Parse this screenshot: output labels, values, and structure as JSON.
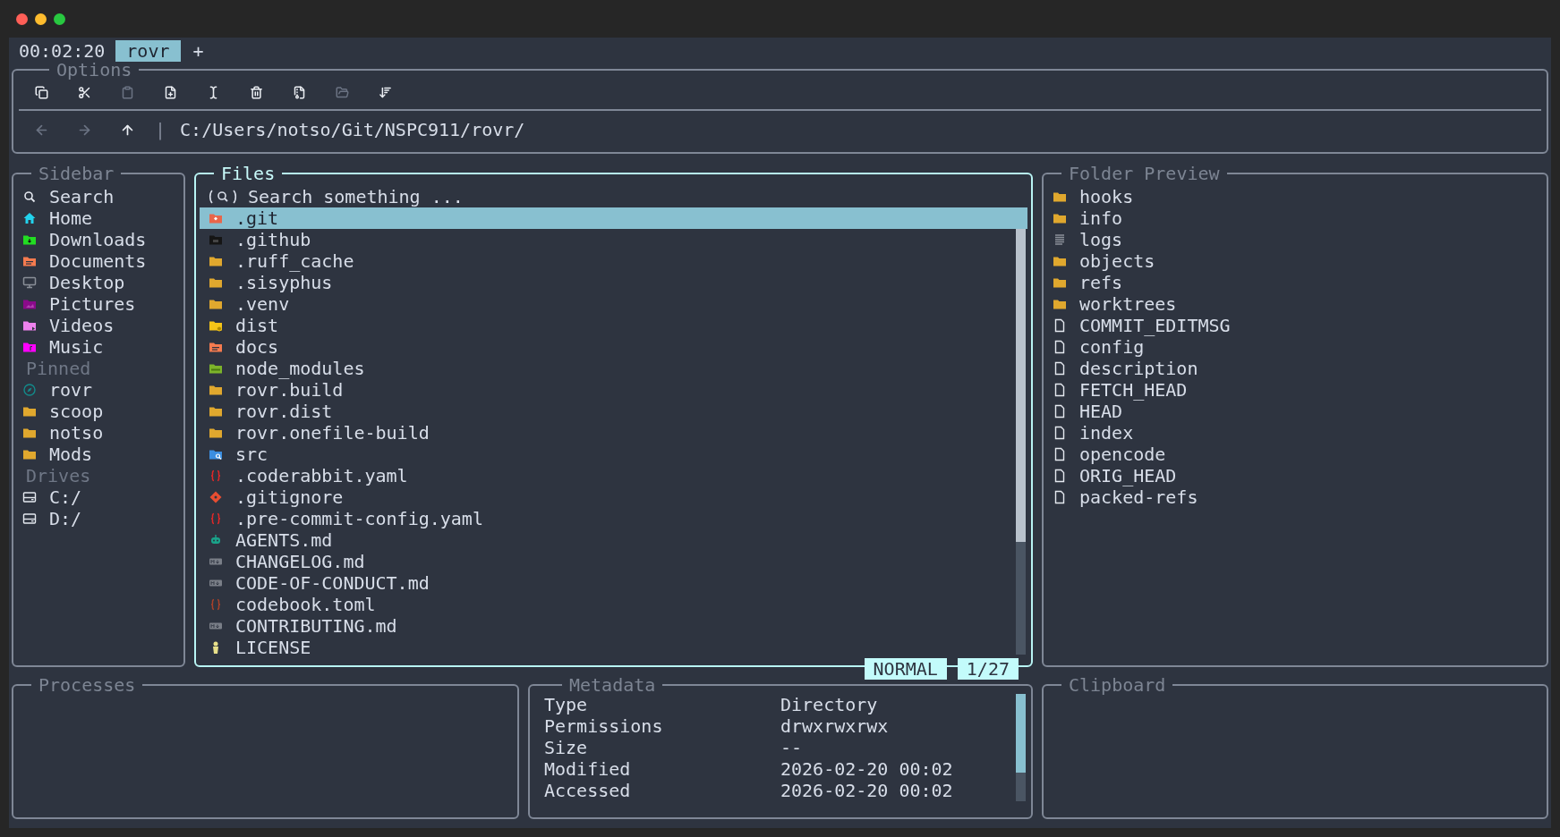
{
  "tab_bar": {
    "clock": "00:02:20",
    "tabs": [
      {
        "label": "rovr",
        "selected": true
      }
    ],
    "new_tab": "+"
  },
  "options": {
    "title": "Options",
    "toolbar": [
      {
        "kind": "copy",
        "disabled": false
      },
      {
        "kind": "cut",
        "disabled": false
      },
      {
        "kind": "paste",
        "disabled": true
      },
      {
        "kind": "new-file",
        "disabled": false
      },
      {
        "kind": "rename",
        "disabled": false
      },
      {
        "kind": "delete",
        "disabled": false
      },
      {
        "kind": "archive",
        "disabled": false
      },
      {
        "kind": "open-folder",
        "disabled": true
      },
      {
        "kind": "sort",
        "disabled": false
      }
    ],
    "nav": [
      {
        "kind": "back",
        "disabled": true
      },
      {
        "kind": "forward",
        "disabled": true
      },
      {
        "kind": "up",
        "disabled": false
      }
    ],
    "separator": "|",
    "path": "C:/Users/notso/Git/NSPC911/rovr/"
  },
  "sidebar": {
    "title": "Sidebar",
    "sections": [
      {
        "items": [
          {
            "label": "Search",
            "kind": "search"
          },
          {
            "label": "Home",
            "kind": "home"
          },
          {
            "label": "Downloads",
            "kind": "folder-download"
          },
          {
            "label": "Documents",
            "kind": "folder-doc"
          },
          {
            "label": "Desktop",
            "kind": "desktop"
          },
          {
            "label": "Pictures",
            "kind": "folder-image"
          },
          {
            "label": "Videos",
            "kind": "folder-video"
          },
          {
            "label": "Music",
            "kind": "folder-music"
          }
        ]
      },
      {
        "heading": "Pinned",
        "items": [
          {
            "label": "rovr",
            "kind": "compass"
          },
          {
            "label": "scoop",
            "kind": "folder"
          },
          {
            "label": "notso",
            "kind": "folder"
          },
          {
            "label": "Mods",
            "kind": "folder"
          }
        ]
      },
      {
        "heading": "Drives",
        "items": [
          {
            "label": "C:/",
            "kind": "drive"
          },
          {
            "label": "D:/",
            "kind": "drive"
          }
        ]
      }
    ]
  },
  "files": {
    "title": "Files",
    "search_placeholder": "Search something ...",
    "rows": [
      {
        "name": ".git",
        "kind": "folder-git",
        "selected": true
      },
      {
        "name": ".github",
        "kind": "folder-github",
        "selected": false
      },
      {
        "name": ".ruff_cache",
        "kind": "folder",
        "selected": false
      },
      {
        "name": ".sisyphus",
        "kind": "folder",
        "selected": false
      },
      {
        "name": ".venv",
        "kind": "folder",
        "selected": false
      },
      {
        "name": "dist",
        "kind": "folder-gear",
        "selected": false
      },
      {
        "name": "docs",
        "kind": "folder-doc",
        "selected": false
      },
      {
        "name": "node_modules",
        "kind": "folder-node",
        "selected": false
      },
      {
        "name": "rovr.build",
        "kind": "folder",
        "selected": false
      },
      {
        "name": "rovr.dist",
        "kind": "folder",
        "selected": false
      },
      {
        "name": "rovr.onefile-build",
        "kind": "folder",
        "selected": false
      },
      {
        "name": "src",
        "kind": "folder-search",
        "selected": false
      },
      {
        "name": ".coderabbit.yaml",
        "kind": "braces",
        "selected": false
      },
      {
        "name": ".gitignore",
        "kind": "git",
        "selected": false
      },
      {
        "name": ".pre-commit-config.yaml",
        "kind": "braces",
        "selected": false
      },
      {
        "name": "AGENTS.md",
        "kind": "robot",
        "selected": false
      },
      {
        "name": "CHANGELOG.md",
        "kind": "markdown",
        "selected": false
      },
      {
        "name": "CODE-OF-CONDUCT.md",
        "kind": "markdown",
        "selected": false
      },
      {
        "name": "codebook.toml",
        "kind": "braces-toml",
        "selected": false
      },
      {
        "name": "CONTRIBUTING.md",
        "kind": "markdown",
        "selected": false
      },
      {
        "name": "LICENSE",
        "kind": "license",
        "selected": false
      }
    ],
    "mode": "NORMAL",
    "position": "1/27"
  },
  "folder_preview": {
    "title": "Folder Preview",
    "items": [
      {
        "name": "hooks",
        "kind": "folder"
      },
      {
        "name": "info",
        "kind": "folder"
      },
      {
        "name": "logs",
        "kind": "logs"
      },
      {
        "name": "objects",
        "kind": "folder"
      },
      {
        "name": "refs",
        "kind": "folder"
      },
      {
        "name": "worktrees",
        "kind": "folder"
      },
      {
        "name": "COMMIT_EDITMSG",
        "kind": "file"
      },
      {
        "name": "config",
        "kind": "file"
      },
      {
        "name": "description",
        "kind": "file"
      },
      {
        "name": "FETCH_HEAD",
        "kind": "file"
      },
      {
        "name": "HEAD",
        "kind": "file"
      },
      {
        "name": "index",
        "kind": "file"
      },
      {
        "name": "opencode",
        "kind": "file"
      },
      {
        "name": "ORIG_HEAD",
        "kind": "file"
      },
      {
        "name": "packed-refs",
        "kind": "file"
      }
    ]
  },
  "processes": {
    "title": "Processes"
  },
  "metadata": {
    "title": "Metadata",
    "rows": [
      {
        "key": "Type",
        "value": "Directory"
      },
      {
        "key": "Permissions",
        "value": "drwxrwxrwx"
      },
      {
        "key": "Size",
        "value": "--"
      },
      {
        "key": "Modified",
        "value": "2026-02-20 00:02"
      },
      {
        "key": "Accessed",
        "value": "2026-02-20 00:02"
      }
    ]
  },
  "clipboard": {
    "title": "Clipboard"
  }
}
